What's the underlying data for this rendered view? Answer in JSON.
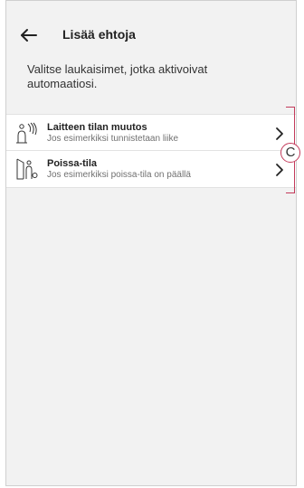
{
  "header": {
    "back_icon": "arrow-left-icon",
    "title": "Lisää ehtoja"
  },
  "intro_text": "Valitse laukaisimet, jotka aktivoivat automaatiosi.",
  "triggers": [
    {
      "icon": "device-state-change-icon",
      "label": "Laitteen tilan muutos",
      "description": "Jos esimerkiksi tunnistetaan liike"
    },
    {
      "icon": "away-mode-icon",
      "label": "Poissa-tila",
      "description": "Jos esimerkiksi poissa-tila on päällä"
    }
  ],
  "annotation": {
    "callout_letter": "C",
    "color": "#c33a5a"
  }
}
